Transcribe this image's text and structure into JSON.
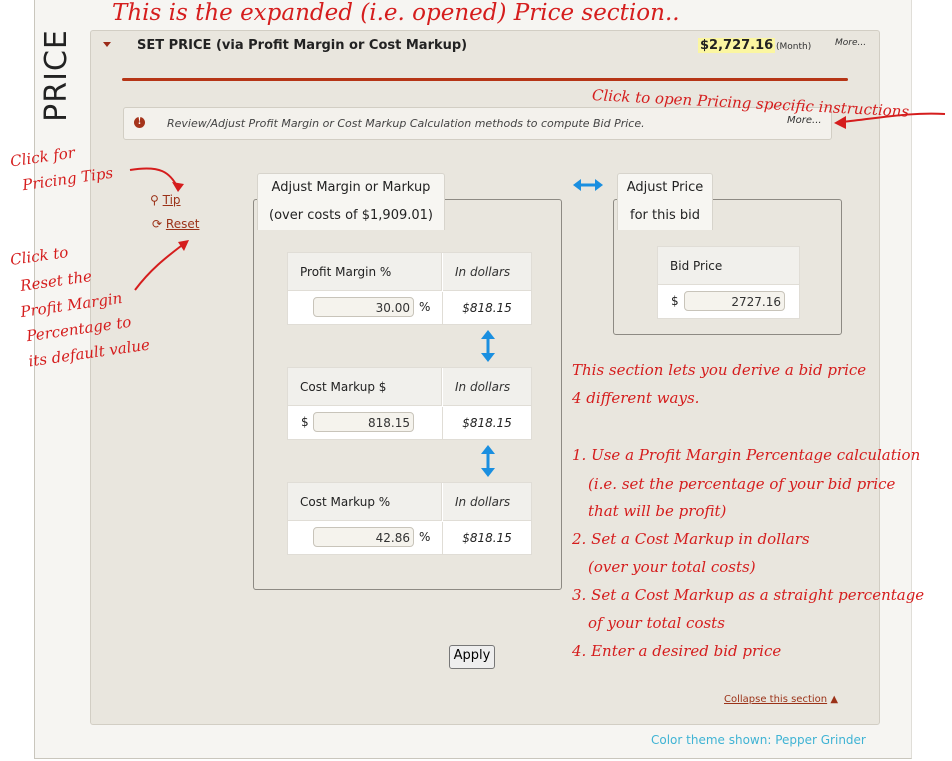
{
  "section_label": "PRICE",
  "header": {
    "title": "SET PRICE (via Profit Margin or Cost Markup)",
    "amount": "$2,727.16",
    "period": "(Month)",
    "more": "More..."
  },
  "info": {
    "icon": "info-icon",
    "text": "Review/Adjust Profit Margin or Cost Markup Calculation methods to compute Bid Price.",
    "more": "More..."
  },
  "links": {
    "tip": "Tip",
    "reset": "Reset"
  },
  "left_box": {
    "title_line1": "Adjust Margin or Markup",
    "title_line2": "(over costs of $1,909.01)",
    "calcs": [
      {
        "label": "Profit Margin %",
        "dollars_header": "In dollars",
        "prefix": "",
        "value": "30.00",
        "suffix": "%",
        "dollars": "$818.15"
      },
      {
        "label": "Cost Markup $",
        "dollars_header": "In dollars",
        "prefix": "$",
        "value": "818.15",
        "suffix": "",
        "dollars": "$818.15"
      },
      {
        "label": "Cost Markup %",
        "dollars_header": "In dollars",
        "prefix": "",
        "value": "42.86",
        "suffix": "%",
        "dollars": "$818.15"
      }
    ]
  },
  "right_box": {
    "title_line1": "Adjust Price",
    "title_line2": "for this bid",
    "bid_label": "Bid Price",
    "prefix": "$",
    "bid_value": "2727.16"
  },
  "apply_label": "Apply",
  "collapse_label": "Collapse this section",
  "theme_note": "Color theme shown: Pepper Grinder",
  "annotations": {
    "title": "This is the expanded (i.e. opened) Price section..",
    "open_instructions": "Click to open Pricing specific instructions",
    "tips_line1": "Click for",
    "tips_line2": "Pricing Tips",
    "reset_lines": [
      "Click to",
      "Reset the",
      "Profit Margin",
      "Percentage to",
      "its default value"
    ],
    "description_lines": [
      "This section lets you derive a bid price",
      "4 different ways.",
      "1. Use a Profit Margin Percentage calculation",
      "(i.e. set the percentage of your bid price",
      "that will be profit)",
      "2. Set a Cost Markup in dollars",
      "(over your total costs)",
      "3. Set a Cost Markup as a straight percentage",
      "of your total costs",
      "4. Enter a desired bid price"
    ]
  },
  "colors": {
    "accent": "#b63516",
    "link": "#9b3218",
    "annotation": "#d51d1d",
    "theme_note": "#3fb3d4",
    "highlight": "#fbf6a1"
  }
}
